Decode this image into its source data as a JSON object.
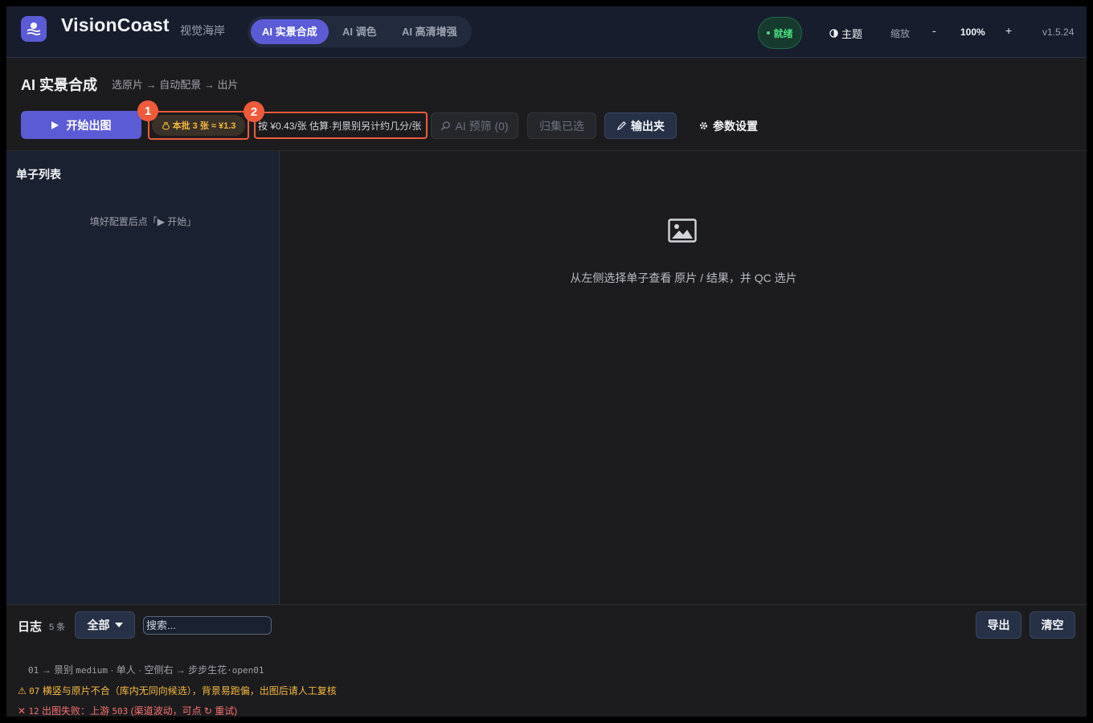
{
  "app": {
    "brand": "VisionCoast",
    "brand_sub": "视觉海岸",
    "tabs": [
      {
        "label": "AI 实景合成"
      },
      {
        "label": "AI 调色"
      },
      {
        "label": "AI 高清增强"
      }
    ],
    "status": "就绪",
    "theme_label": "主题",
    "zoom_label": "缩放",
    "zoom_minus": "-",
    "zoom_value": "100%",
    "zoom_plus": "+",
    "version": "v1.5.24"
  },
  "header": {
    "title": "AI 实景合成",
    "breadcrumb": "选原片 → 自动配景 → 出片"
  },
  "toolbar": {
    "start_label": "开始出图",
    "cost_label": "本批 3 张 ≈ ¥1.3",
    "estimate_label": "按 ¥0.43/张 估算·判景别另计约几分/张",
    "marker1": "1",
    "marker2": "2",
    "screen_label": "AI 预筛 (0)",
    "collect_label": "归集已选",
    "output_label": "输出夹",
    "params_label": "参数设置"
  },
  "sidebar": {
    "title": "单子列表",
    "hint": "填好配置后点「▶ 开始」"
  },
  "main": {
    "hint": "从左侧选择单子查看 原片 / 结果，并 QC 选片"
  },
  "log": {
    "title": "日志",
    "count": "5 条",
    "filter_value": "全部",
    "search_placeholder": "搜索...",
    "export_label": "导出",
    "clear_label": "清空",
    "line1": {
      "num": "01",
      "a": "→",
      "b": "景别",
      "c": "medium",
      "d": "·",
      "e": "单人",
      "f": "·",
      "g": "空侧右",
      "h": "→",
      "i": "步步生花",
      "j": "·open01"
    },
    "line2": {
      "icon": "⚠",
      "num": "07",
      "text": "横竖与原片不合（库内无同向候选），背景易跑偏，出图后请人工复核"
    },
    "line3": {
      "icon": "✕",
      "num": "12",
      "text_a": "出图失败：上游",
      "code": "503",
      "text_b": "(渠道波动，可点 ↻ 重试)"
    }
  },
  "colors": {
    "accent": "#5b5bd6",
    "warning": "#f5b83d",
    "error": "#f87171",
    "ok": "#4ade80",
    "highlight": "#ef5a3b"
  }
}
